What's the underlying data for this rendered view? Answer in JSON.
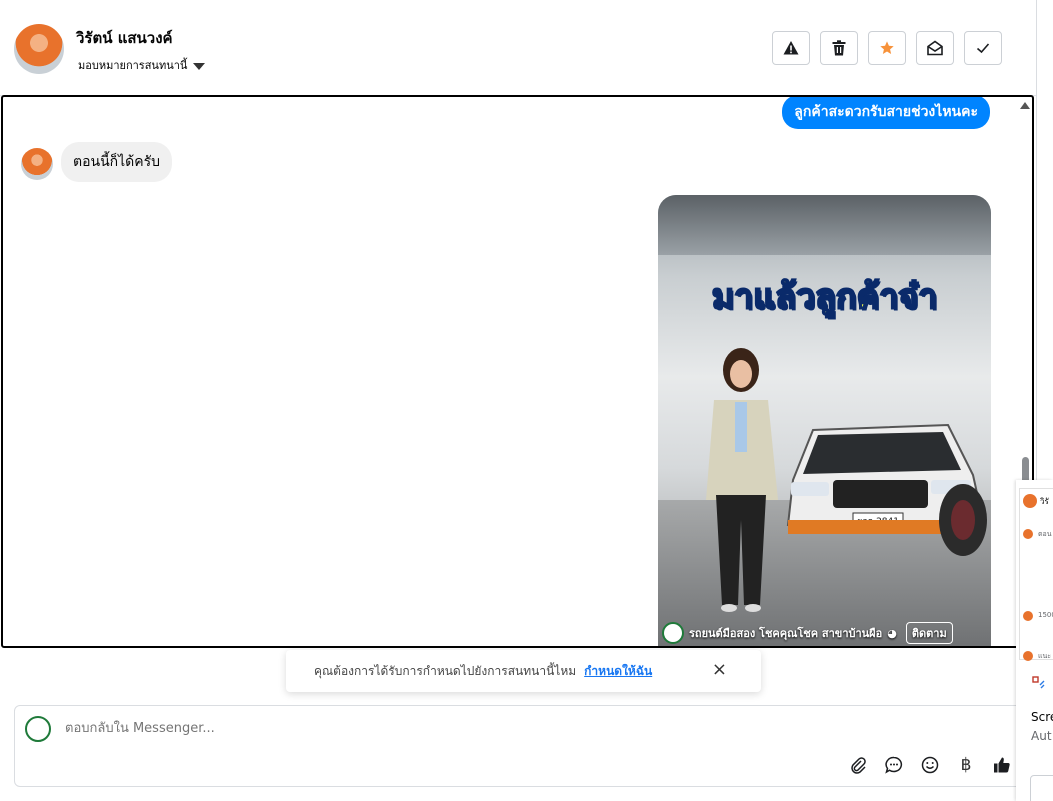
{
  "header": {
    "contact_name": "วิรัตน์ แสนวงค์",
    "assign_label": "มอบหมายการสนทนานี้",
    "buttons": [
      {
        "name": "report-button",
        "icon": "warning-icon"
      },
      {
        "name": "delete-button",
        "icon": "trash-icon"
      },
      {
        "name": "star-button",
        "icon": "star-icon",
        "color": "#f7923a"
      },
      {
        "name": "mark-unread-button",
        "icon": "envelope-open-icon"
      },
      {
        "name": "mark-done-button",
        "icon": "check-icon"
      }
    ]
  },
  "messages": {
    "outgoing_text": "ลูกค้าสะดวกรับสายช่วงไหนคะ",
    "incoming_text": "ตอนนี้ก็ได้ครับ",
    "video": {
      "overlay_title": "มาแล้วลูกค้าจ๋า",
      "caption": "รถยนต์มือสอง โชคคุณโชค สาขาบ้านผือ",
      "follow_label": "ติดตาม",
      "plate": "ยกล 2841"
    }
  },
  "toast": {
    "text": "คุณต้องการได้รับการกำหนดไปยังการสนทนานี้ไหม",
    "link": "กำหนดให้ฉัน",
    "close": "×"
  },
  "composer": {
    "placeholder": "ตอบกลับใน Messenger...",
    "icons": [
      "paperclip-icon",
      "saved-reply-icon",
      "emoji-icon",
      "baht-icon",
      "thumbs-up-icon"
    ],
    "baht_glyph": "฿"
  },
  "side_overlay": {
    "name_snippet": "วิรั",
    "lines": [
      "ตอน",
      "1500",
      "แนะ"
    ],
    "card_text_1": "Scre",
    "card_text_2": "Aut"
  },
  "colors": {
    "accent": "#0084ff",
    "star": "#f7923a",
    "link": "#1877f2"
  }
}
